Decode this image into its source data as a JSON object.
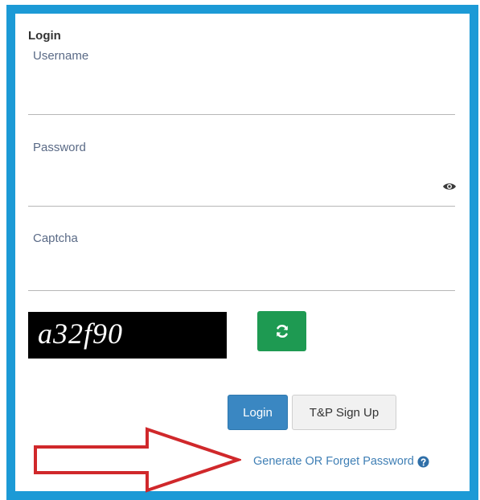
{
  "form": {
    "title": "Login",
    "username": {
      "label": "Username",
      "value": ""
    },
    "password": {
      "label": "Password",
      "value": ""
    },
    "captcha": {
      "label": "Captcha",
      "value": ""
    }
  },
  "captcha_image": {
    "text": "a32f90"
  },
  "icons": {
    "eye": "eye-icon",
    "refresh": "refresh-icon",
    "help": "question-circle-icon"
  },
  "buttons": {
    "login_label": "Login",
    "signup_label": "T&P Sign Up"
  },
  "links": {
    "forgot_password": "Generate OR Forget Password"
  },
  "colors": {
    "frame_border": "#1c9ad6",
    "login_button": "#3a87c2",
    "refresh_button": "#1e9a52",
    "link": "#3f7fb5",
    "annotation_arrow": "#d0282b"
  }
}
